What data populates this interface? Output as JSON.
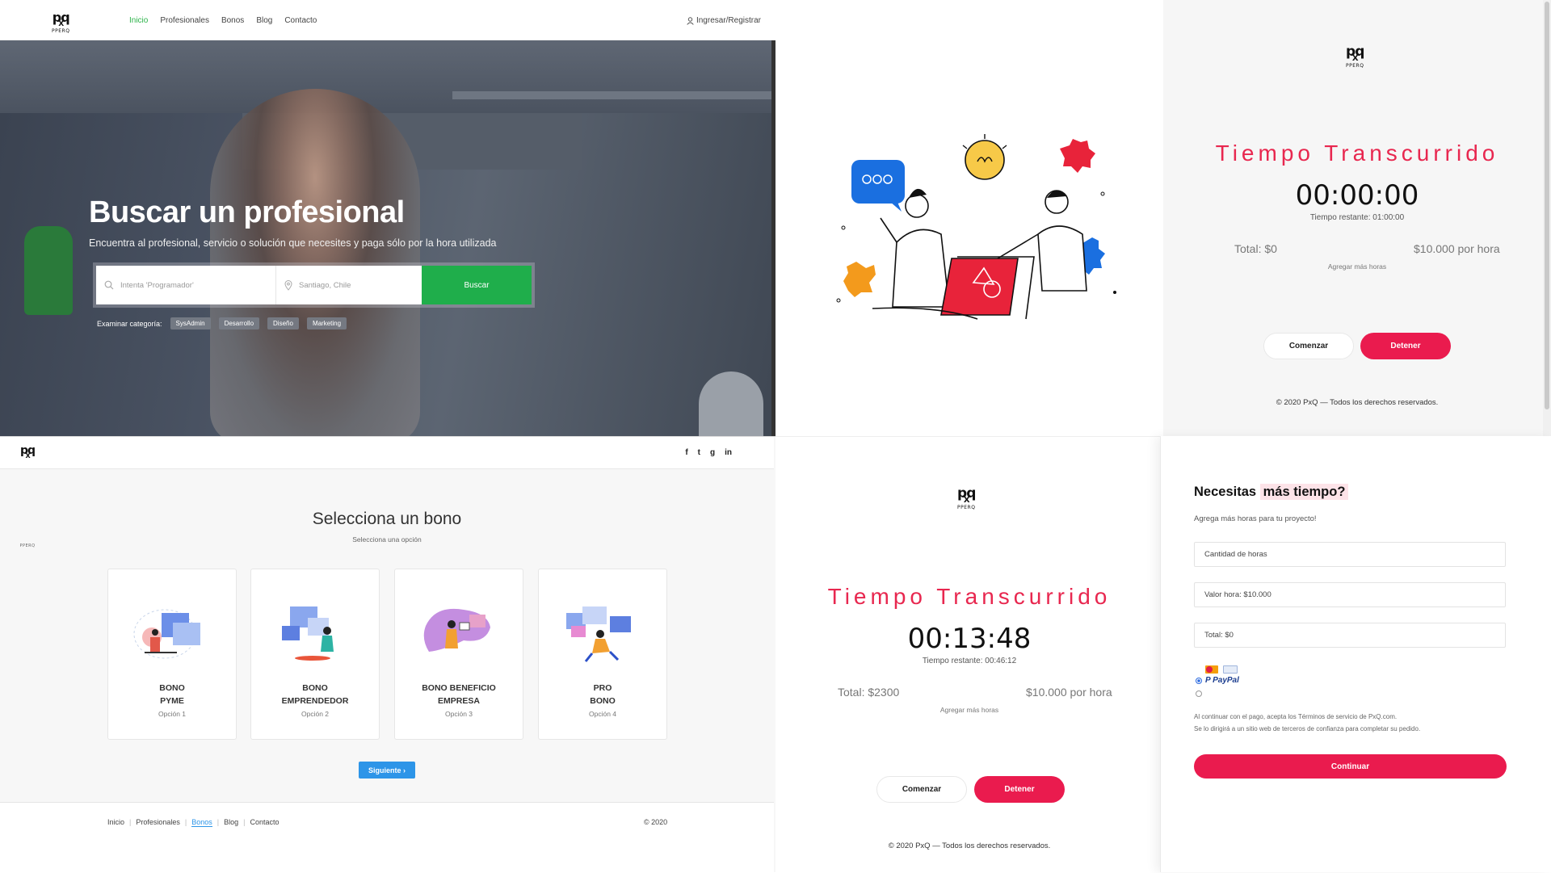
{
  "brand": {
    "mark": "pq",
    "x": "X",
    "sub": "PPERQ"
  },
  "landing": {
    "nav": [
      "Inicio",
      "Profesionales",
      "Bonos",
      "Blog",
      "Contacto"
    ],
    "login": "Ingresar/Registrar",
    "title": "Buscar un profesional",
    "lead": "Encuentra al profesional, servicio o solución que necesites y paga sólo por la hora utilizada",
    "search_placeholder": "Intenta 'Programador'",
    "location_placeholder": "Santiago, Chile",
    "search_button": "Buscar",
    "categories_label": "Examinar categoría:",
    "categories": [
      "SysAdmin",
      "Desarrollo",
      "Diseño",
      "Marketing"
    ]
  },
  "timer_top": {
    "title": "Tiempo Transcurrido",
    "elapsed": "00:00:00",
    "remaining": "Tiempo restante: 01:00:00",
    "total": "Total: $0",
    "rate": "$10.000 por hora",
    "add_hours": "Agregar más horas",
    "start": "Comenzar",
    "stop": "Detener",
    "copyright": "© 2020 PxQ — Todos los derechos reservados."
  },
  "bonos": {
    "social": [
      "f",
      "t",
      "g",
      "in"
    ],
    "title": "Selecciona un bono",
    "subtitle": "Selecciona una opción",
    "cards": [
      {
        "line1": "BONO",
        "line2": "PYME",
        "option": "Opción 1"
      },
      {
        "line1": "BONO",
        "line2": "EMPRENDEDOR",
        "option": "Opción 2"
      },
      {
        "line1": "BONO BENEFICIO",
        "line2": "EMPRESA",
        "option": "Opción 3"
      },
      {
        "line1": "PRO",
        "line2": "BONO",
        "option": "Opción 4"
      }
    ],
    "next": "Siguiente",
    "footer_links": [
      "Inicio",
      "Profesionales",
      "Bonos",
      "Blog",
      "Contacto"
    ],
    "footer_copy": "© 2020"
  },
  "timer_bottom": {
    "title": "Tiempo Transcurrido",
    "elapsed": "00:13:48",
    "remaining": "Tiempo restante: 00:46:12",
    "total": "Total: $2300",
    "rate": "$10.000 por hora",
    "add_hours": "Agregar más horas",
    "start": "Comenzar",
    "stop": "Detener",
    "copyright": "© 2020 PxQ — Todos los derechos reservados."
  },
  "payment": {
    "title_a": "Necesitas ",
    "title_b": "más tiempo?",
    "lead": "Agrega más horas para tu proyecto!",
    "hours_placeholder": "Cantidad de horas",
    "hour_value": "Valor hora: $10.000",
    "total": "Total: $0",
    "paypal": "PayPal",
    "terms_1": "Al continuar con el pago, acepta los Términos de servicio de PxQ.com.",
    "terms_2": "Se lo dirigirá a un sitio web de terceros de confianza para completar su pedido.",
    "continue": "Continuar"
  },
  "colors": {
    "accent_red": "#ea1b4e",
    "green": "#1fae4b",
    "blue": "#2d95e8"
  }
}
